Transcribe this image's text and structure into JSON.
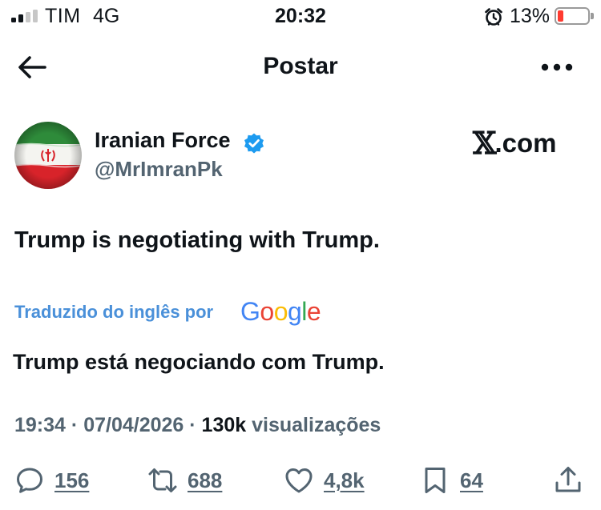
{
  "status_bar": {
    "carrier": "TIM",
    "network": "4G",
    "time": "20:32",
    "battery_percent": "13%",
    "battery_color": "#ff3b30",
    "icons": [
      "signal-icon",
      "alarm-icon",
      "battery-icon"
    ]
  },
  "header": {
    "title": "Postar",
    "icons": [
      "back-arrow-icon",
      "more-icon"
    ]
  },
  "tweet": {
    "author": {
      "display_name": "Iranian Force",
      "handle": "@MrImranPk",
      "verified": true,
      "verified_color": "#1d9bf0"
    },
    "watermark": {
      "mark": "𝕏",
      "text": ".com"
    },
    "text": "Trump is negotiating with Trump.",
    "translation": {
      "label": "Traduzido do inglês por",
      "provider": "Google",
      "text": "Trump está negociando com Trump."
    },
    "meta": {
      "time": "19:34",
      "separator": "·",
      "date": "07/04/2026",
      "views_count": "130k",
      "views_label": "visualizações"
    },
    "actions": {
      "replies": "156",
      "reposts": "688",
      "likes": "4,8k",
      "bookmarks": "64"
    }
  }
}
